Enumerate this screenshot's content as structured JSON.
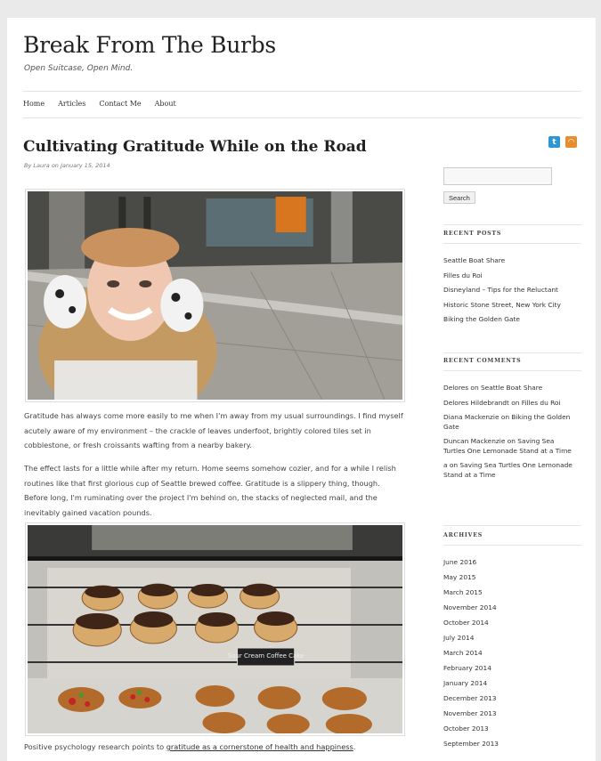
{
  "site": {
    "title": "Break From The Burbs",
    "description": "Open Suitcase, Open Mind."
  },
  "nav": [
    "Home",
    "Articles",
    "Contact Me",
    "About"
  ],
  "post": {
    "title": "Cultivating Gratitude While on the Road",
    "meta": "By Laura on January 15, 2014",
    "paragraph1": "Gratitude has always come more easily to me when I'm away from my usual surroundings. I find myself acutely aware of my environment – the crackle of leaves underfoot, brightly colored tiles set in cobblestone, or fresh croissants wafting from a nearby bakery.",
    "paragraph2": "The effect lasts for a little while after my return. Home seems somehow cozier, and for a while I relish routines like that first glorious cup of Seattle brewed coffee. Gratitude is a slippery thing, though. Before long, I'm ruminating over the project I'm behind on, the stacks of neglected mail, and the inevitably gained vacation pounds.",
    "paragraph3_prefix": "Positive psychology research points to ",
    "paragraph3_link": "gratitude as a cornerstone of health and happiness",
    "paragraph3_suffix": "."
  },
  "search": {
    "button_label": "Search",
    "value": ""
  },
  "recent_posts": {
    "title": "RECENT POSTS",
    "items": [
      "Seattle Boat Share",
      "Filles du Roi",
      "Disneyland – Tips for the Reluctant",
      "Historic Stone Street, New York City",
      "Biking the Golden Gate"
    ]
  },
  "recent_comments": {
    "title": "RECENT COMMENTS",
    "items": [
      "Delores on Seattle Boat Share",
      "Delores Hildebrandt on Filles du Roi",
      "Diana Mackenzie on Biking the Golden Gate",
      "Duncan Mackenzie on Saving Sea Turtles One Lemonade Stand at a Time",
      "a on Saving Sea Turtles One Lemonade Stand at a Time"
    ]
  },
  "archives": {
    "title": "ARCHIVES",
    "items": [
      "June 2016",
      "May 2015",
      "March 2015",
      "November 2014",
      "October 2014",
      "July 2014",
      "March 2014",
      "February 2014",
      "January 2014",
      "December 2013",
      "November 2013",
      "October 2013",
      "September 2013"
    ]
  },
  "image_cake_sign": "Sour Cream Coffee Cake",
  "colors": {
    "twitter": "#2b95d6",
    "rss": "#e88d2d"
  },
  "icons": [
    "twitter-icon",
    "rss-icon"
  ]
}
